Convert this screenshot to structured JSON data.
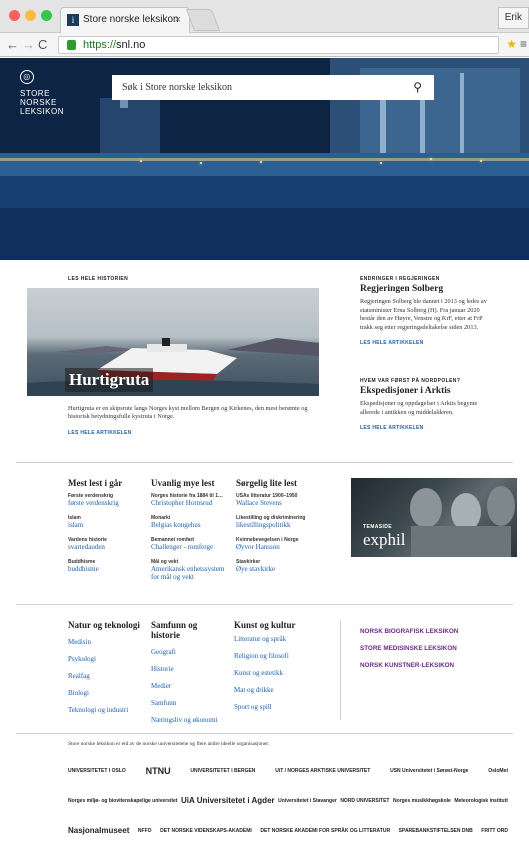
{
  "browser": {
    "tab_title": "Store norske leksikon",
    "tab_favicon": "i",
    "tab_close": "×",
    "user_button": "Erik",
    "url_secure": "https://",
    "url_host": "snl.no"
  },
  "header": {
    "logo_lines": [
      "STORE",
      "NORSKE",
      "LEKSIKON"
    ],
    "search_placeholder": "Søk i Store norske leksikon"
  },
  "main_story": {
    "kicker": "LES HELE HISTORIEN",
    "title": "Hurtigruta",
    "text": "Hurtigruta er en skipsrute langs Norges kyst mellom Bergen og Kirkenes, den mest berømte og historisk betydningsfulle kystruta i Norge.",
    "read_more": "LES HELE ARTIKKELEN"
  },
  "side_stories": [
    {
      "kicker": "ENDRINGER I REGJERINGEN",
      "title": "Regjeringen Solberg",
      "text": "Regjeringen Solberg ble dannet i 2013 og ledes av statsminister Erna Solberg (H). Fra januar 2020 består den av Høyre, Venstre og KrF, etter at FrP trakk seg etter regjeringsdeltakelse siden 2013.",
      "read_more": "LES HELE ARTIKKELEN"
    },
    {
      "kicker": "HVEM VAR FØRST PÅ NORDPOLEN?",
      "title": "Ekspedisjoner i Arktis",
      "text": "Ekspedisjoner og oppdagelser i Arktis begynte allerede i antikken og middelalderen.",
      "read_more": "LES HELE ARTIKKELEN"
    }
  ],
  "lists": [
    {
      "title": "Mest lest i går",
      "items": [
        {
          "cat": "Første verdenskrig",
          "link": "første verdenskrig"
        },
        {
          "cat": "Islam",
          "link": "islam"
        },
        {
          "cat": "Vardens historie",
          "link": "svartedauden"
        },
        {
          "cat": "Buddhisme",
          "link": "buddhisme"
        }
      ]
    },
    {
      "title": "Uvanlig mye lest",
      "items": [
        {
          "cat": "Norges historie fra 1884 til 1…",
          "link": "Christopher Hornsrud"
        },
        {
          "cat": "Monarki",
          "link": "Belgias kongehus"
        },
        {
          "cat": "Bemannet romfart",
          "link": "Challenger - romferge"
        },
        {
          "cat": "Mål og vekt",
          "link": "Amerikansk enhetssystem for mål og vekt"
        }
      ]
    },
    {
      "title": "Sørgelig lite lest",
      "items": [
        {
          "cat": "USAs litteratur 1900–1950",
          "link": "Wallace Stevens"
        },
        {
          "cat": "Likestilling og diskriminering",
          "link": "likestillingspolitikk"
        },
        {
          "cat": "Kvinnebevegelsen i Norge",
          "link": "Øyvor Hansson"
        },
        {
          "cat": "Stavkirker",
          "link": "Øye stavkirke"
        }
      ]
    }
  ],
  "theme_box": {
    "kicker": "TEMASIDE",
    "title": "exphil"
  },
  "categories": [
    {
      "title": "Natur og teknologi",
      "items": [
        "Medisin",
        "Psykologi",
        "Realfag",
        "Biologi",
        "Teknologi og industri"
      ]
    },
    {
      "title": "Samfunn og historie",
      "items": [
        "Geografi",
        "Historie",
        "Medier",
        "Samfunn",
        "Næringsliv og økonomi"
      ]
    },
    {
      "title": "Kunst og kultur",
      "items": [
        "Litteratur og språk",
        "Religion og filosofi",
        "Kunst og estetikk",
        "Mat og drikke",
        "Sport og spill"
      ]
    }
  ],
  "sister_sites": [
    "NORSK BIOGRAFISK LEKSIKON",
    "STORE MEDISINSKE LEKSIKON",
    "NORSK KUNSTNER-LEKSIKON"
  ],
  "footer": {
    "owners_text": "Store norske leksikon er eid av de norske universitetene og flere andre ideelle organisasjoner:",
    "orgs": [
      [
        "UNIVERSITETET I OSLO",
        "NTNU",
        "UNIVERSITETET I BERGEN",
        "UiT / NORGES ARKTISKE UNIVERSITET",
        "USN Universitetet i Sørøst-Norge",
        "OsloMet"
      ],
      [
        "Norges miljø- og biovitenskapelige universitet",
        "UiA Universitetet i Agder",
        "Universitetet i Stavanger",
        "NORD UNIVERSITET",
        "Norges musikkhøgskole",
        "Meteorologisk institutt"
      ],
      [
        "Nasjonalmuseet",
        "NFFO",
        "DET NORSKE VIDENSKAPS-AKADEMI",
        "DET NORSKE AKADEMI FOR SPRÅK OG LITTERATUR",
        "SPAREBANKSTIFTELSEN DNB",
        "FRITT ORD"
      ]
    ]
  },
  "colors": {
    "link": "#1a5fb4",
    "sister": "#6b2a8a",
    "hero_sea": "#1c4a7a"
  }
}
